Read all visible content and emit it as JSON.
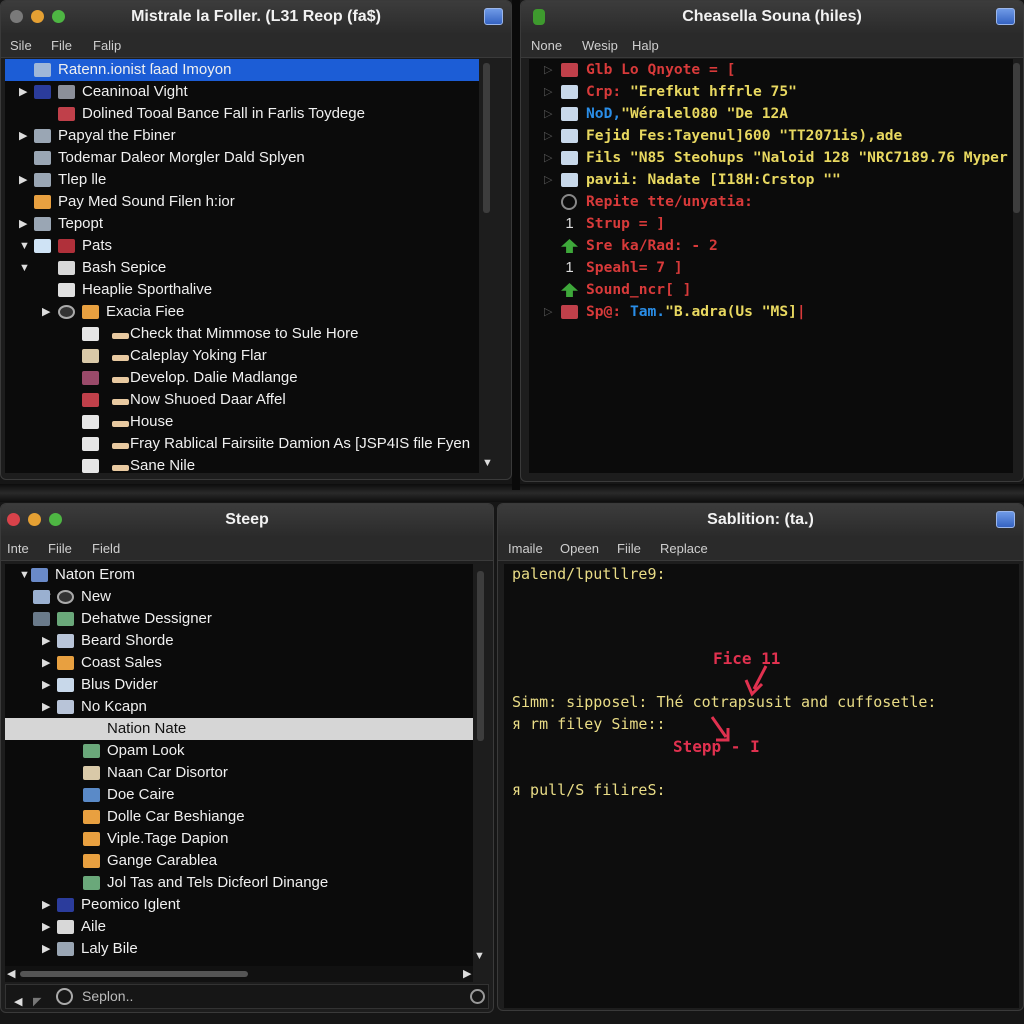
{
  "colors": {
    "select_blue": "#1c5dd6",
    "code_red": "#d83a3a",
    "code_yellow": "#e8d860",
    "code_blue": "#2a8ee8",
    "annotation": "#e0314f"
  },
  "win_tl": {
    "title": "Mistrale la Foller. (L31 Reop (fa$)",
    "menu": [
      "Sile",
      "File",
      "Falip"
    ],
    "rows": [
      {
        "label": "Ratenn.ionist ſaad Imoyon",
        "depth": 0,
        "arrow": "",
        "icons": [
          "image"
        ],
        "selected": true
      },
      {
        "label": "Ceaninoal Vight",
        "depth": 1,
        "arrow": "right",
        "icons": [
          "drive-blue",
          "disk"
        ]
      },
      {
        "label": "Dolined Tooal Bance Fall in Farlis Toydege",
        "depth": 1,
        "arrow": "",
        "icons": [
          "image-red"
        ]
      },
      {
        "label": "Papyal the Fbiner",
        "depth": 0,
        "arrow": "right",
        "icons": [
          "folder-gray"
        ]
      },
      {
        "label": "Todemar Daleor Morgler Dald Splyen",
        "depth": 0,
        "arrow": "",
        "icons": [
          "folder-gray"
        ]
      },
      {
        "label": "Tlep lle",
        "depth": 0,
        "arrow": "right",
        "icons": [
          "folder-gray"
        ]
      },
      {
        "label": "Pay Med Sound Filen h:ior",
        "depth": 0,
        "arrow": "",
        "icons": [
          "folder-orange"
        ]
      },
      {
        "label": "Tepopt",
        "depth": 0,
        "arrow": "right",
        "icons": [
          "folder-gray"
        ]
      },
      {
        "label": "Pats",
        "depth": 1,
        "arrow": "down",
        "icons": [
          "phone",
          "tools-red"
        ]
      },
      {
        "label": "Bash Sepice",
        "depth": 1,
        "arrow": "down",
        "icons": [
          "document"
        ]
      },
      {
        "label": "Heaplie Sporthalive",
        "depth": 1,
        "arrow": "",
        "icons": [
          "page"
        ]
      },
      {
        "label": "Exacia Fiee",
        "depth": 2,
        "arrow": "right",
        "icons": [
          "clock",
          "folder-orange"
        ]
      },
      {
        "label": "Check that Mimmose to Sule Hore",
        "depth": 3,
        "arrow": "",
        "icons": [
          "battery",
          "mark"
        ]
      },
      {
        "label": "Caleplay Yoking Flar",
        "depth": 3,
        "arrow": "",
        "icons": [
          "box",
          "mark"
        ]
      },
      {
        "label": "Develop. Dalie Madlange",
        "depth": 3,
        "arrow": "",
        "icons": [
          "flower",
          "mark"
        ]
      },
      {
        "label": "Now Shuoed Daar Affel",
        "depth": 3,
        "arrow": "",
        "icons": [
          "image-red",
          "mark"
        ]
      },
      {
        "label": "House",
        "depth": 3,
        "arrow": "",
        "icons": [
          "battery",
          "mark"
        ]
      },
      {
        "label": "Fray Rablical Fairsiite Damion As [JSP4IS file Fyen",
        "depth": 3,
        "arrow": "",
        "icons": [
          "battery",
          "mark"
        ]
      },
      {
        "label": "Sane Nile",
        "depth": 3,
        "arrow": "",
        "icons": [
          "battery",
          "mark"
        ]
      }
    ]
  },
  "win_tr": {
    "title": "Cheasella Souna (hiles)",
    "menu": [
      "None",
      "Wesip",
      "Halp"
    ],
    "lines": [
      {
        "icon": "image-red",
        "parts": [
          {
            "text": "Glb Lo Qnyote = [",
            "color": "red"
          }
        ]
      },
      {
        "icon": "table",
        "parts": [
          {
            "text": "Crp:",
            "color": "red"
          },
          {
            "text": "\"Erefkut hffrle 75\"",
            "color": "yellow"
          }
        ]
      },
      {
        "icon": "table",
        "parts": [
          {
            "text": "NoD,",
            "color": "blue"
          },
          {
            "text": "\"Wéralel080 \"De 12A",
            "color": "yellow"
          }
        ]
      },
      {
        "icon": "table",
        "parts": [
          {
            "text": "Fejid Fes:Tayenul]600 \"TT2071is),ade",
            "color": "yellow"
          }
        ]
      },
      {
        "icon": "table",
        "parts": [
          {
            "text": "Fils \"N85 Steohups \"Naloid 128 \"NRC7189.76 Myper",
            "color": "yellow"
          }
        ]
      },
      {
        "icon": "table",
        "parts": [
          {
            "text": "pavii: Nadate [I18H:Crstop \"\"",
            "color": "yellow"
          }
        ]
      },
      {
        "icon": "circle",
        "parts": [
          {
            "text": "Repite tte/unyatia:",
            "color": "red"
          }
        ]
      },
      {
        "icon": "one",
        "parts": [
          {
            "text": "Strup = ]",
            "color": "red"
          }
        ]
      },
      {
        "icon": "green-arrow",
        "parts": [
          {
            "text": "Sre ka/Rad: - 2",
            "color": "red"
          }
        ]
      },
      {
        "icon": "one",
        "parts": [
          {
            "text": "Speahl= 7 ]",
            "color": "red"
          }
        ]
      },
      {
        "icon": "green-arrow",
        "parts": [
          {
            "text": "Sound_ncr[ ]",
            "color": "red"
          }
        ]
      },
      {
        "icon": "image-red",
        "parts": [
          {
            "text": "Sp@:",
            "color": "red"
          },
          {
            "text": "Tam.",
            "color": "blue"
          },
          {
            "text": "\"B.adra(Us \"MS]",
            "color": "yellow"
          },
          {
            "text": "|",
            "color": "red"
          }
        ]
      }
    ]
  },
  "win_bl": {
    "title": "Steep",
    "menu": [
      "Inte",
      "Fiile",
      "Field"
    ],
    "rows": [
      {
        "label": "Naton Erom",
        "depth": 0,
        "arrow": "down",
        "icons": [
          "globe"
        ]
      },
      {
        "label": "New",
        "depth": 1,
        "arrow": "down",
        "icons": [
          "calendar",
          "clock"
        ]
      },
      {
        "label": "Dehatwe Dessigner",
        "depth": 1,
        "arrow": "",
        "icons": [
          "small",
          "image-green"
        ]
      },
      {
        "label": "Beard Shorde",
        "depth": 1,
        "arrow": "right",
        "icons": [
          "drive-gray"
        ]
      },
      {
        "label": "Coast Sales",
        "depth": 1,
        "arrow": "right",
        "icons": [
          "folder-orange"
        ]
      },
      {
        "label": "Blus Dvider",
        "depth": 1,
        "arrow": "right",
        "icons": [
          "table"
        ]
      },
      {
        "label": "No Kcapn",
        "depth": 1,
        "arrow": "right",
        "icons": [
          "drive-gray"
        ]
      },
      {
        "label": "Nation Nate",
        "depth": 2,
        "arrow": "",
        "icons": [],
        "selected": true
      },
      {
        "label": "Opam Look",
        "depth": 2,
        "arrow": "",
        "icons": [
          "image-green"
        ]
      },
      {
        "label": "Naan Car Disortor",
        "depth": 2,
        "arrow": "",
        "icons": [
          "box"
        ]
      },
      {
        "label": "Doe Caire",
        "depth": 2,
        "arrow": "",
        "icons": [
          "image-blue"
        ]
      },
      {
        "label": "Dolle Car Beshiange",
        "depth": 2,
        "arrow": "",
        "icons": [
          "folder-orange"
        ]
      },
      {
        "label": "Viple.Tage Dapion",
        "depth": 2,
        "arrow": "",
        "icons": [
          "folder-orange"
        ]
      },
      {
        "label": "Gange Carablea",
        "depth": 2,
        "arrow": "",
        "icons": [
          "folder-orange"
        ]
      },
      {
        "label": "Jol Tas and Tels Dicfeorl Dinange",
        "depth": 2,
        "arrow": "",
        "icons": [
          "image-green"
        ]
      },
      {
        "label": "Peomico Iglent",
        "depth": 1,
        "arrow": "right",
        "icons": [
          "drive-blue"
        ]
      },
      {
        "label": "Aile",
        "depth": 1,
        "arrow": "right",
        "icons": [
          "document"
        ]
      },
      {
        "label": "Laly Bile",
        "depth": 1,
        "arrow": "right",
        "icons": [
          "folder-gray"
        ]
      }
    ],
    "status": "Seplon.."
  },
  "win_br": {
    "title": "Sablition: (ta.)",
    "menu": [
      "Imaile",
      "Opeen",
      "Fiile",
      "Replace"
    ],
    "lines": [
      "palend/lputllre9:",
      "Simm: sipposel: Thé cotrapsusit and cuffosetle:",
      "я rm filey Sime::",
      "я pull/S filireS:"
    ],
    "annotations": [
      "Fice 11",
      "Stepp - I"
    ]
  }
}
